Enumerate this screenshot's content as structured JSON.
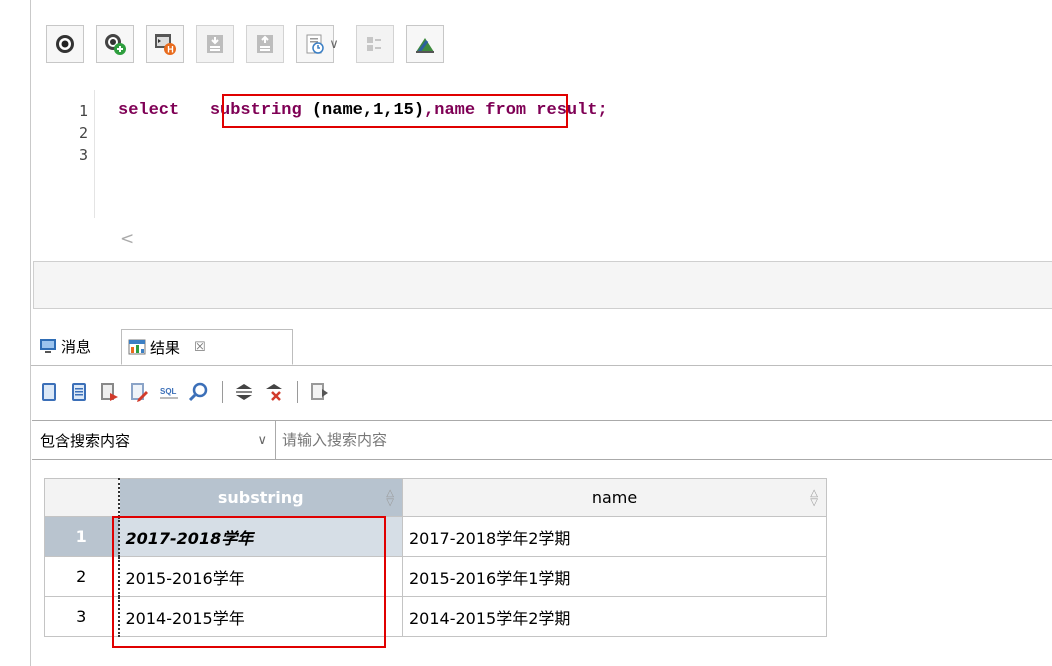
{
  "toolbar": {
    "buttons": [
      {
        "name": "run-icon"
      },
      {
        "name": "run-selected-icon"
      },
      {
        "name": "explain-icon"
      },
      {
        "name": "import-icon"
      },
      {
        "name": "export-icon"
      },
      {
        "name": "history-icon"
      },
      {
        "name": "format-icon"
      },
      {
        "name": "designer-icon"
      }
    ]
  },
  "editor": {
    "line_numbers": [
      "1",
      "2",
      "3"
    ],
    "tokens": {
      "select": "select",
      "substring": "substring",
      "args": " (name,1,15)",
      "rest_name": ",name ",
      "from": "from",
      "rest_table": " result;"
    }
  },
  "tabs": {
    "messages": "消息",
    "results": "结果"
  },
  "search": {
    "mode": "包含搜索内容",
    "placeholder": "请输入搜索内容"
  },
  "grid": {
    "columns": [
      "substring",
      "name"
    ],
    "rows": [
      {
        "num": "1",
        "substring": "2017-2018学年",
        "name": "2017-2018学年2学期"
      },
      {
        "num": "2",
        "substring": "2015-2016学年",
        "name": "2015-2016学年1学期"
      },
      {
        "num": "3",
        "substring": "2014-2015学年",
        "name": "2014-2015学年2学期"
      }
    ]
  },
  "colors": {
    "highlight": "#e00000",
    "keyword": "#7f0055",
    "selected_header": "#b7c3cf"
  }
}
